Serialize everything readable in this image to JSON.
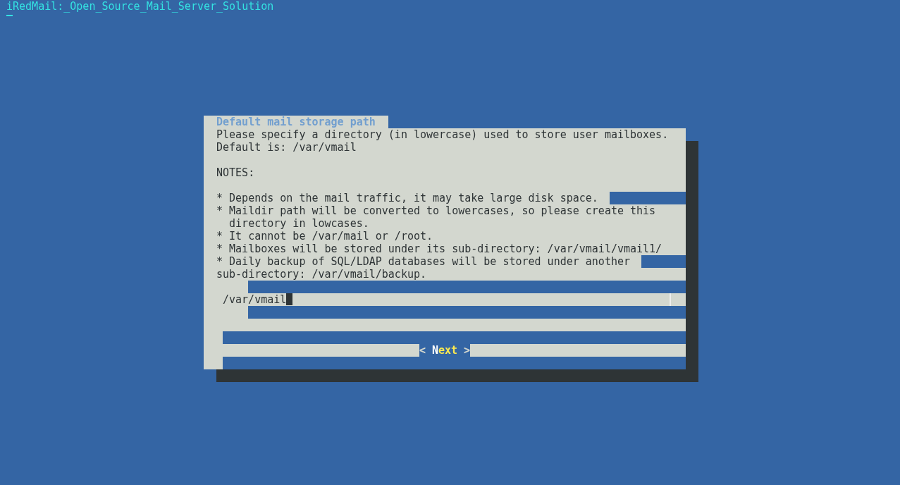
{
  "terminal": {
    "title": "iRedMail:_Open_Source_Mail_Server_Solution"
  },
  "dialog": {
    "title": "Default mail storage path",
    "message": [
      "Please specify a directory (in lowercase) used to store user mailboxes.",
      "Default is: /var/vmail"
    ],
    "notes_heading": "NOTES:",
    "notes": [
      "* Depends on the mail traffic, it may take large disk space.",
      "* Maildir path will be converted to lowercases, so please create this",
      "  directory in lowcases.",
      "* It cannot be /var/mail or /root.",
      "* Mailboxes will be stored under its sub-directory: /var/vmail/vmail1/",
      "* Daily backup of SQL/LDAP databases will be stored under another",
      "sub-directory: /var/vmail/backup."
    ],
    "input": {
      "value": "/var/vmail"
    },
    "button": {
      "label": "< Next >",
      "selected": true
    }
  }
}
